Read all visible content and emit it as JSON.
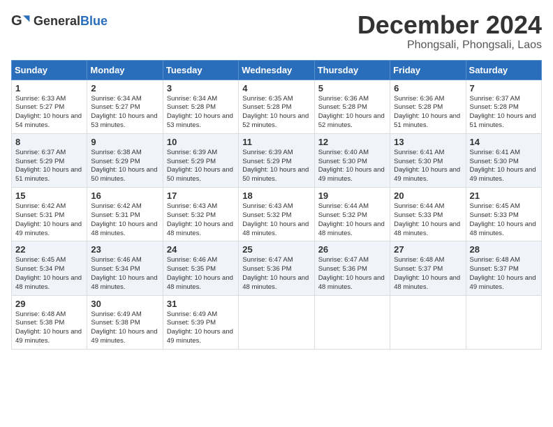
{
  "header": {
    "logo_general": "General",
    "logo_blue": "Blue",
    "month_title": "December 2024",
    "location": "Phongsali, Phongsali, Laos"
  },
  "weekdays": [
    "Sunday",
    "Monday",
    "Tuesday",
    "Wednesday",
    "Thursday",
    "Friday",
    "Saturday"
  ],
  "weeks": [
    [
      {
        "day": "1",
        "sunrise": "6:33 AM",
        "sunset": "5:27 PM",
        "daylight": "10 hours and 54 minutes."
      },
      {
        "day": "2",
        "sunrise": "6:34 AM",
        "sunset": "5:27 PM",
        "daylight": "10 hours and 53 minutes."
      },
      {
        "day": "3",
        "sunrise": "6:34 AM",
        "sunset": "5:28 PM",
        "daylight": "10 hours and 53 minutes."
      },
      {
        "day": "4",
        "sunrise": "6:35 AM",
        "sunset": "5:28 PM",
        "daylight": "10 hours and 52 minutes."
      },
      {
        "day": "5",
        "sunrise": "6:36 AM",
        "sunset": "5:28 PM",
        "daylight": "10 hours and 52 minutes."
      },
      {
        "day": "6",
        "sunrise": "6:36 AM",
        "sunset": "5:28 PM",
        "daylight": "10 hours and 51 minutes."
      },
      {
        "day": "7",
        "sunrise": "6:37 AM",
        "sunset": "5:28 PM",
        "daylight": "10 hours and 51 minutes."
      }
    ],
    [
      {
        "day": "8",
        "sunrise": "6:37 AM",
        "sunset": "5:29 PM",
        "daylight": "10 hours and 51 minutes."
      },
      {
        "day": "9",
        "sunrise": "6:38 AM",
        "sunset": "5:29 PM",
        "daylight": "10 hours and 50 minutes."
      },
      {
        "day": "10",
        "sunrise": "6:39 AM",
        "sunset": "5:29 PM",
        "daylight": "10 hours and 50 minutes."
      },
      {
        "day": "11",
        "sunrise": "6:39 AM",
        "sunset": "5:29 PM",
        "daylight": "10 hours and 50 minutes."
      },
      {
        "day": "12",
        "sunrise": "6:40 AM",
        "sunset": "5:30 PM",
        "daylight": "10 hours and 49 minutes."
      },
      {
        "day": "13",
        "sunrise": "6:41 AM",
        "sunset": "5:30 PM",
        "daylight": "10 hours and 49 minutes."
      },
      {
        "day": "14",
        "sunrise": "6:41 AM",
        "sunset": "5:30 PM",
        "daylight": "10 hours and 49 minutes."
      }
    ],
    [
      {
        "day": "15",
        "sunrise": "6:42 AM",
        "sunset": "5:31 PM",
        "daylight": "10 hours and 49 minutes."
      },
      {
        "day": "16",
        "sunrise": "6:42 AM",
        "sunset": "5:31 PM",
        "daylight": "10 hours and 48 minutes."
      },
      {
        "day": "17",
        "sunrise": "6:43 AM",
        "sunset": "5:32 PM",
        "daylight": "10 hours and 48 minutes."
      },
      {
        "day": "18",
        "sunrise": "6:43 AM",
        "sunset": "5:32 PM",
        "daylight": "10 hours and 48 minutes."
      },
      {
        "day": "19",
        "sunrise": "6:44 AM",
        "sunset": "5:32 PM",
        "daylight": "10 hours and 48 minutes."
      },
      {
        "day": "20",
        "sunrise": "6:44 AM",
        "sunset": "5:33 PM",
        "daylight": "10 hours and 48 minutes."
      },
      {
        "day": "21",
        "sunrise": "6:45 AM",
        "sunset": "5:33 PM",
        "daylight": "10 hours and 48 minutes."
      }
    ],
    [
      {
        "day": "22",
        "sunrise": "6:45 AM",
        "sunset": "5:34 PM",
        "daylight": "10 hours and 48 minutes."
      },
      {
        "day": "23",
        "sunrise": "6:46 AM",
        "sunset": "5:34 PM",
        "daylight": "10 hours and 48 minutes."
      },
      {
        "day": "24",
        "sunrise": "6:46 AM",
        "sunset": "5:35 PM",
        "daylight": "10 hours and 48 minutes."
      },
      {
        "day": "25",
        "sunrise": "6:47 AM",
        "sunset": "5:36 PM",
        "daylight": "10 hours and 48 minutes."
      },
      {
        "day": "26",
        "sunrise": "6:47 AM",
        "sunset": "5:36 PM",
        "daylight": "10 hours and 48 minutes."
      },
      {
        "day": "27",
        "sunrise": "6:48 AM",
        "sunset": "5:37 PM",
        "daylight": "10 hours and 48 minutes."
      },
      {
        "day": "28",
        "sunrise": "6:48 AM",
        "sunset": "5:37 PM",
        "daylight": "10 hours and 49 minutes."
      }
    ],
    [
      {
        "day": "29",
        "sunrise": "6:48 AM",
        "sunset": "5:38 PM",
        "daylight": "10 hours and 49 minutes."
      },
      {
        "day": "30",
        "sunrise": "6:49 AM",
        "sunset": "5:38 PM",
        "daylight": "10 hours and 49 minutes."
      },
      {
        "day": "31",
        "sunrise": "6:49 AM",
        "sunset": "5:39 PM",
        "daylight": "10 hours and 49 minutes."
      },
      null,
      null,
      null,
      null
    ]
  ]
}
